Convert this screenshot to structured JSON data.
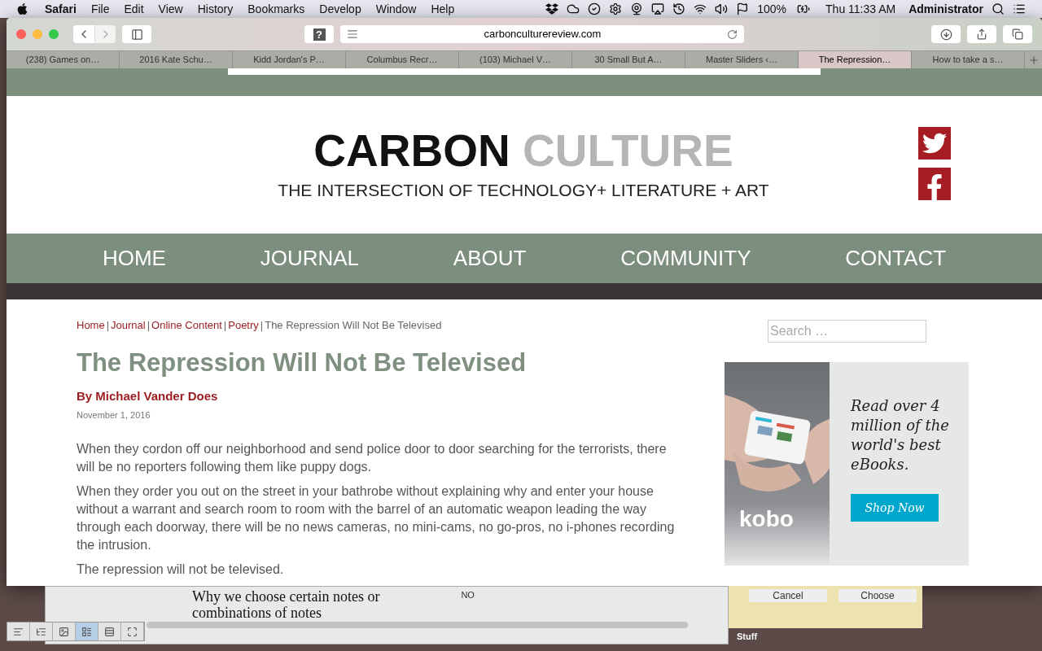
{
  "menubar": {
    "app": "Safari",
    "items": [
      "File",
      "Edit",
      "View",
      "History",
      "Bookmarks",
      "Develop",
      "Window",
      "Help"
    ],
    "battery": "100%",
    "clock": "Thu 11:33 AM",
    "user": "Administrator"
  },
  "toolbar": {
    "url": "carbonculturereview.com",
    "help": "?"
  },
  "tabs": [
    {
      "label": "(238) Games on…",
      "selected": false
    },
    {
      "label": "2016 Kate Schu…",
      "selected": false
    },
    {
      "label": "Kidd Jordan's P…",
      "selected": false
    },
    {
      "label": "Columbus Recr…",
      "selected": false
    },
    {
      "label": "(103) Michael V…",
      "selected": false
    },
    {
      "label": "30 Small But A…",
      "selected": false
    },
    {
      "label": "Master Sliders ‹…",
      "selected": false
    },
    {
      "label": "The Repression…",
      "selected": true
    },
    {
      "label": "How to take a s…",
      "selected": false
    }
  ],
  "site": {
    "logo": {
      "word1": "CARBON",
      "word2": "CULTURE",
      "tagline": "THE INTERSECTION OF TECHNOLOGY+ LITERATURE + ART"
    },
    "nav": [
      "HOME",
      "JOURNAL",
      "ABOUT",
      "COMMUNITY",
      "CONTACT"
    ],
    "breadcrumb_separator": "|",
    "breadcrumb": [
      {
        "label": "Home",
        "kind": "link"
      },
      {
        "label": "Journal",
        "kind": "link"
      },
      {
        "label": "Online Content",
        "kind": "link"
      },
      {
        "label": "Poetry",
        "kind": "link"
      },
      {
        "label": "The Repression Will Not Be Televised",
        "kind": "current"
      }
    ],
    "title": "The Repression Will Not Be Televised",
    "byline": "By Michael Vander Does",
    "date": "November 1, 2016",
    "paragraphs": [
      "When they cordon off our neighborhood and send police door to door searching for the terrorists, there will be no reporters following them like puppy dogs.",
      "When they order you out on the street in your bathrobe without explaining why and enter your house without a warrant and search room to room with the barrel of an automatic weapon leading the way through each doorway, there will be no news cameras, no mini-cams, no go-pros, no i-phones recording the intrusion.",
      "The repression will not be televised."
    ],
    "search": {
      "placeholder": "Search …"
    },
    "ad": {
      "brand": "kobo",
      "text": "Read over 4 million of the world's best eBooks.",
      "button": "Shop Now"
    }
  },
  "background": {
    "lines": [
      "Why we choose certain notes or",
      "combinations of notes"
    ],
    "label": "NO",
    "buttons": [
      "Cancel",
      "Choose"
    ],
    "folder": "Stuff"
  }
}
